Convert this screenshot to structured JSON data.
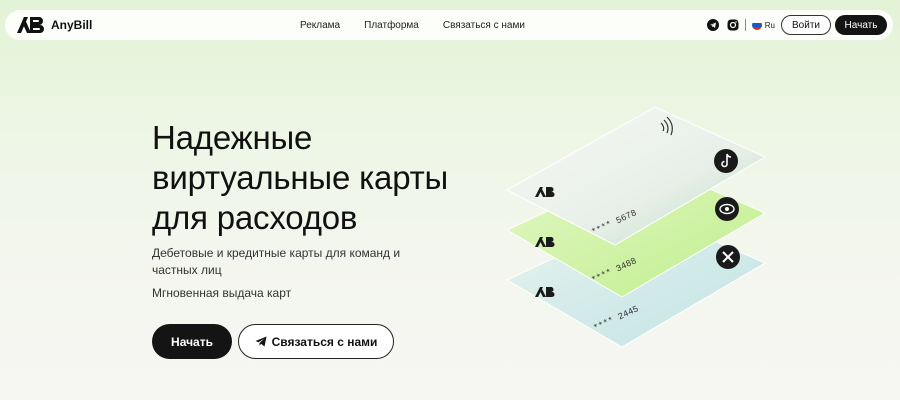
{
  "header": {
    "brand": "AnyBill",
    "nav": [
      {
        "label": "Реклама"
      },
      {
        "label": "Платформа"
      },
      {
        "label": "Связаться с нами"
      }
    ],
    "language": "Ru",
    "login_label": "Войти",
    "start_label": "Начать"
  },
  "hero": {
    "title_lines": [
      "Надежные",
      "виртуальные карты",
      "для расходов"
    ],
    "subtitle": "Дебетовые и кредитные карты для команд и частных лиц",
    "tagline": "Мгновенная выдача карт",
    "cta_primary": "Начать",
    "cta_secondary": "Связаться с нами"
  },
  "cards": [
    {
      "number": "**** 5678",
      "service_icon": "tiktok-icon"
    },
    {
      "number": "**** 3488",
      "service_icon": "eye-icon"
    },
    {
      "number": "**** 2445",
      "service_icon": "x-icon"
    }
  ],
  "colors": {
    "accent_dark": "#141414",
    "card_green": "#cdf3a6",
    "card_white": "#f3f6f1",
    "card_blue": "#dbeff0"
  },
  "icons": [
    "telegram-icon",
    "instagram-icon",
    "russia-flag-icon",
    "contactless-icon",
    "telegram-send-icon"
  ]
}
